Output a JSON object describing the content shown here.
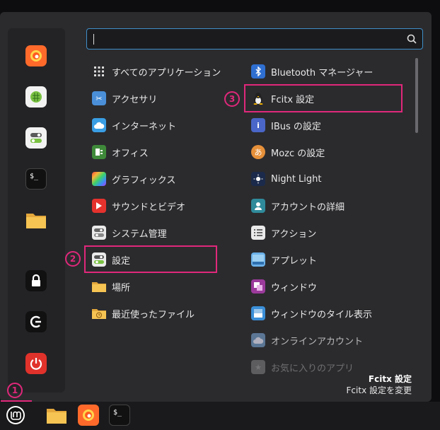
{
  "search": {
    "value": "",
    "placeholder": ""
  },
  "categories": [
    {
      "label": "すべてのアプリケーション",
      "icon": "grid-icon"
    },
    {
      "label": "アクセサリ",
      "icon": "scissors-icon"
    },
    {
      "label": "インターネット",
      "icon": "cloud-icon"
    },
    {
      "label": "オフィス",
      "icon": "office-icon"
    },
    {
      "label": "グラフィックス",
      "icon": "graphics-icon"
    },
    {
      "label": "サウンドとビデオ",
      "icon": "play-icon"
    },
    {
      "label": "システム管理",
      "icon": "system-icon"
    },
    {
      "label": "設定",
      "icon": "settings-toggle-icon"
    },
    {
      "label": "場所",
      "icon": "folder-icon"
    },
    {
      "label": "最近使ったファイル",
      "icon": "recent-files-icon"
    }
  ],
  "apps": [
    {
      "label": "Bluetooth マネージャー",
      "icon": "bluetooth-icon"
    },
    {
      "label": "Fcitx 設定",
      "icon": "penguin-icon"
    },
    {
      "label": "IBus の設定",
      "icon": "ibus-icon"
    },
    {
      "label": "Mozc の設定",
      "icon": "mozc-icon"
    },
    {
      "label": "Night Light",
      "icon": "night-light-icon"
    },
    {
      "label": "アカウントの詳細",
      "icon": "account-icon"
    },
    {
      "label": "アクション",
      "icon": "actions-icon"
    },
    {
      "label": "アプレット",
      "icon": "applet-icon"
    },
    {
      "label": "ウィンドウ",
      "icon": "windows-icon"
    },
    {
      "label": "ウィンドウのタイル表示",
      "icon": "window-tiling-icon"
    },
    {
      "label": "オンラインアカウント",
      "icon": "online-accounts-icon"
    },
    {
      "label": "お気に入りのアプリ",
      "icon": "favorite-apps-icon"
    }
  ],
  "info": {
    "title": "Fcitx 設定",
    "description": "Fcitx 設定を変更"
  },
  "annotations": {
    "one": "1",
    "two": "2",
    "three": "3"
  },
  "colors": {
    "highlight": "#e0287a",
    "search_border": "#3f8fc9"
  }
}
